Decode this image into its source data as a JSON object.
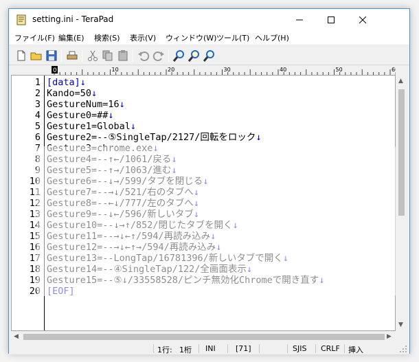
{
  "window": {
    "title": "setting.ini - TeraPad",
    "accent": "#0000cc"
  },
  "menu": [
    "ファイル(F)",
    "編集(E)",
    "検索(S)",
    "表示(V)",
    "ウィンドウ(W)",
    "ツール(T)",
    "ヘルプ(H)"
  ],
  "toolbar_icons": [
    "new-file-icon",
    "open-folder-icon",
    "save-icon",
    "print-icon",
    "cut-icon",
    "copy-icon",
    "paste-icon",
    "undo-icon",
    "redo-icon",
    "find-icon",
    "find-next-icon",
    "find-prev-icon"
  ],
  "ruler": {
    "origin": "0",
    "ticks": [
      "10",
      "20",
      "30",
      "40",
      "50",
      "60"
    ]
  },
  "lines": [
    {
      "num": "1",
      "text": "[data]",
      "kind": "tag"
    },
    {
      "num": "2",
      "text": "Kando=50",
      "kind": "text"
    },
    {
      "num": "3",
      "text": "GestureNum=16",
      "kind": "text"
    },
    {
      "num": "4",
      "text": "Gesture0=##",
      "kind": "text"
    },
    {
      "num": "5",
      "text": "Gesture1=Global",
      "kind": "text"
    },
    {
      "num": "6",
      "text": "Gesture2=--⑤SingleTap/2127/回転をロック",
      "kind": "text"
    },
    {
      "num": "7",
      "text": "Gesture3=chrome.exe",
      "kind": "text"
    },
    {
      "num": "8",
      "text": "Gesture4=--↑←/1061/戻る",
      "kind": "text"
    },
    {
      "num": "9",
      "text": "Gesture5=--↑→/1063/進む",
      "kind": "text"
    },
    {
      "num": "10",
      "text": "Gesture6=--↓→/599/タブを閉じる",
      "kind": "text"
    },
    {
      "num": "11",
      "text": "Gesture7=--→↓/521/右のタブへ",
      "kind": "text"
    },
    {
      "num": "12",
      "text": "Gesture8=--←↓/777/左のタブへ",
      "kind": "text"
    },
    {
      "num": "13",
      "text": "Gesture9=--↓←/596/新しいタブ",
      "kind": "text"
    },
    {
      "num": "14",
      "text": "Gesture10=--↓→↑/852/閉じたタブを開く",
      "kind": "text"
    },
    {
      "num": "15",
      "text": "Gesture11=--→↓←↑/594/再読み込み",
      "kind": "text"
    },
    {
      "num": "16",
      "text": "Gesture12=--→↓←↑→/594/再読み込み",
      "kind": "text"
    },
    {
      "num": "17",
      "text": "Gesture13=--LongTap/16781396/新しいタブで開く",
      "kind": "text"
    },
    {
      "num": "18",
      "text": "Gesture14=--④SingleTap/122/全画面表示",
      "kind": "text"
    },
    {
      "num": "19",
      "text": "Gesture15=--⑤↓/33558528/ピンチ無効化Chromeで開き直す",
      "kind": "text"
    },
    {
      "num": "20",
      "text": "[EOF]",
      "kind": "eof"
    }
  ],
  "newline_mark": "↓",
  "status": {
    "row": "1行:",
    "col": "1桁",
    "type": "INI",
    "code_point": "[71]",
    "encoding": "SJIS",
    "line_ending": "CRLF",
    "mode": "挿入"
  }
}
